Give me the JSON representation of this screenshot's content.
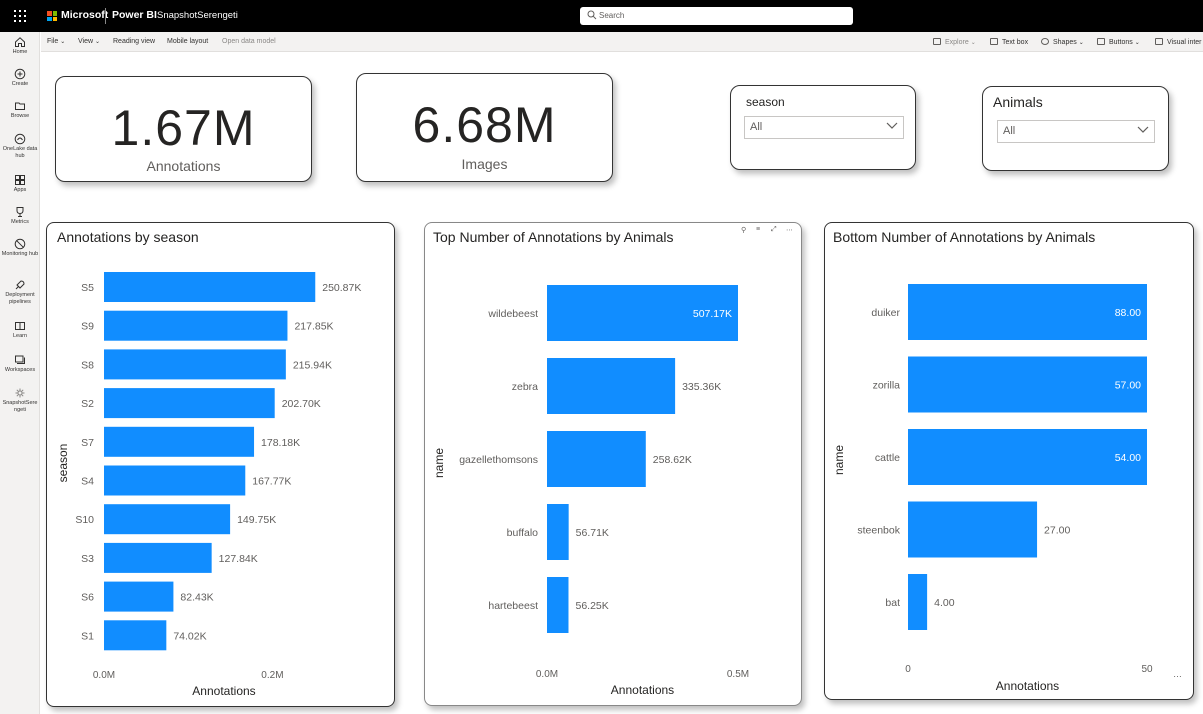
{
  "topbar": {
    "brand": "Microsoft",
    "product": "Power BI",
    "report_name": "SnapshotSerengeti",
    "search_placeholder": "Search"
  },
  "leftnav": [
    {
      "label": "Home",
      "icon": "home-icon"
    },
    {
      "label": "Create",
      "icon": "create-icon"
    },
    {
      "label": "Browse",
      "icon": "browse-icon"
    },
    {
      "label": "OneLake data hub",
      "icon": "onelake-icon"
    },
    {
      "label": "Apps",
      "icon": "apps-icon"
    },
    {
      "label": "Metrics",
      "icon": "metrics-icon"
    },
    {
      "label": "Monitoring hub",
      "icon": "monitoring-icon"
    },
    {
      "label": "Deployment pipelines",
      "icon": "deployment-icon"
    },
    {
      "label": "Learn",
      "icon": "learn-icon"
    },
    {
      "label": "Workspaces",
      "icon": "workspaces-icon"
    },
    {
      "label": "SnapshotSerengeti",
      "icon": "workspace-item-icon"
    }
  ],
  "toolbar": {
    "file": "File",
    "view": "View",
    "reading_view": "Reading view",
    "mobile_layout": "Mobile layout",
    "open_data_model": "Open data model",
    "explore": "Explore",
    "text_box": "Text box",
    "shapes": "Shapes",
    "buttons": "Buttons",
    "visual_interactions": "Visual inter"
  },
  "kpis": [
    {
      "value": "1.67M",
      "label": "Annotations"
    },
    {
      "value": "6.68M",
      "label": "Images"
    }
  ],
  "slicers": [
    {
      "title": "season",
      "value": "All"
    },
    {
      "title": "Animals",
      "value": "All"
    }
  ],
  "colors": {
    "bar": "#118DFF",
    "accent": "#F2C811"
  },
  "chart_data": [
    {
      "type": "bar",
      "orientation": "horizontal",
      "title": "Annotations by season",
      "xlabel": "Annotations",
      "ylabel": "season",
      "categories": [
        "S5",
        "S9",
        "S8",
        "S2",
        "S7",
        "S4",
        "S10",
        "S3",
        "S6",
        "S1"
      ],
      "values": [
        250870,
        217850,
        215940,
        202700,
        178180,
        167770,
        149750,
        127840,
        82430,
        74020
      ],
      "data_labels": [
        "250.87K",
        "217.85K",
        "215.94K",
        "202.70K",
        "178.18K",
        "167.77K",
        "149.75K",
        "127.84K",
        "82.43K",
        "74.02K"
      ],
      "xticks": [
        "0.0M",
        "0.2M"
      ],
      "xtick_values": [
        0,
        200000
      ],
      "xlim": [
        0,
        285000
      ]
    },
    {
      "type": "bar",
      "orientation": "horizontal",
      "title": "Top Number of Annotations by Animals",
      "xlabel": "Annotations",
      "ylabel": "name",
      "categories": [
        "wildebeest",
        "zebra",
        "gazellethomsons",
        "buffalo",
        "hartebeest"
      ],
      "values": [
        507170,
        335360,
        258620,
        56710,
        56250
      ],
      "data_labels": [
        "507.17K",
        "335.36K",
        "258.62K",
        "56.71K",
        "56.25K"
      ],
      "xticks": [
        "0.0M",
        "0.5M"
      ],
      "xtick_values": [
        0,
        500000
      ],
      "xlim": [
        0,
        500000
      ]
    },
    {
      "type": "bar",
      "orientation": "horizontal",
      "title": "Bottom Number of Annotations by Animals",
      "xlabel": "Annotations",
      "ylabel": "name",
      "categories": [
        "duiker",
        "zorilla",
        "cattle",
        "steenbok",
        "bat"
      ],
      "values": [
        88,
        57,
        54,
        27,
        4
      ],
      "data_labels": [
        "88.00",
        "57.00",
        "54.00",
        "27.00",
        "4.00"
      ],
      "xticks": [
        "0",
        "50"
      ],
      "xtick_values": [
        0,
        50
      ],
      "xlim": [
        0,
        50
      ]
    }
  ]
}
